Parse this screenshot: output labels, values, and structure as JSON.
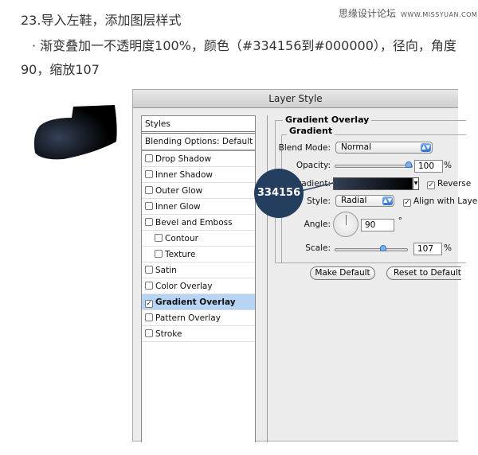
{
  "article": {
    "heading": "23.导入左鞋，添加图层样式",
    "line2": "· 渐变叠加一不透明度100%，颜色（#334156到#000000），径向，角度",
    "line3": "90，缩放107",
    "watermark": "思缘设计论坛",
    "watermark_url": "WWW.MISSYUAN.COM"
  },
  "dialog": {
    "title": "Layer Style",
    "styles_header": "Styles",
    "blending": "Blending Options: Default",
    "items": [
      {
        "label": "Drop Shadow",
        "checked": false
      },
      {
        "label": "Inner Shadow",
        "checked": false
      },
      {
        "label": "Outer Glow",
        "checked": false
      },
      {
        "label": "Inner Glow",
        "checked": false
      },
      {
        "label": "Bevel and Emboss",
        "checked": false
      },
      {
        "label": "Contour",
        "checked": false,
        "sub": true
      },
      {
        "label": "Texture",
        "checked": false,
        "sub": true
      },
      {
        "label": "Satin",
        "checked": false
      },
      {
        "label": "Color Overlay",
        "checked": false
      },
      {
        "label": "Gradient Overlay",
        "checked": true,
        "selected": true
      },
      {
        "label": "Pattern Overlay",
        "checked": false
      },
      {
        "label": "Stroke",
        "checked": false
      }
    ],
    "panel": {
      "section": "Gradient Overlay",
      "group": "Gradient",
      "blend_label": "Blend Mode:",
      "blend_value": "Normal",
      "opacity_label": "Opacity:",
      "opacity_value": "100",
      "opacity_pct": 100,
      "percent": "%",
      "gradient_label": "Gradient:",
      "reverse_label": "Reverse",
      "reverse_checked": true,
      "style_label": "Style:",
      "style_value": "Radial",
      "align_label": "Align with Layer",
      "align_checked": true,
      "angle_label": "Angle:",
      "angle_value": "90",
      "degree": "°",
      "scale_label": "Scale:",
      "scale_value": "107",
      "make_default": "Make Default",
      "reset_default": "Reset to Default"
    }
  },
  "callout": {
    "text": "334156"
  },
  "colors": {
    "gradient_start": "#334156",
    "gradient_end": "#000000",
    "selection": "#b8d4f4"
  }
}
